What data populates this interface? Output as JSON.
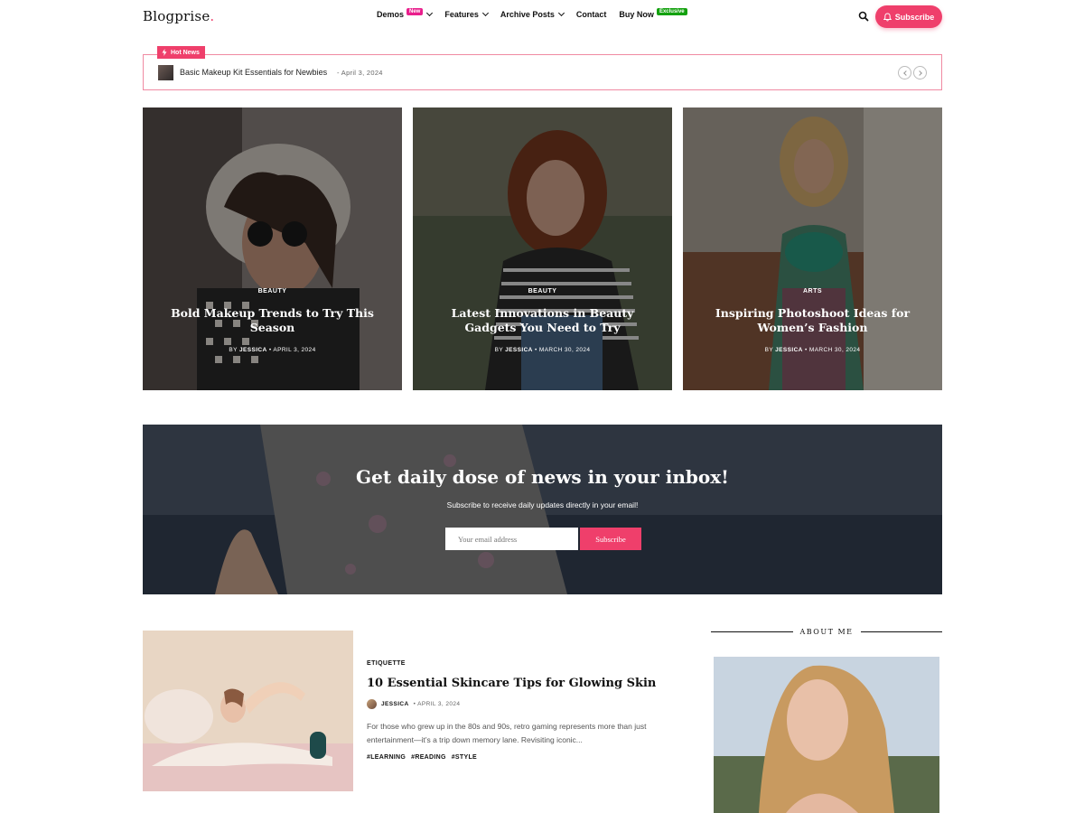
{
  "header": {
    "logo": "Blogprise",
    "logo_dot": ".",
    "nav": [
      {
        "label": "Demos",
        "badge": "New",
        "dropdown": true
      },
      {
        "label": "Features",
        "dropdown": true
      },
      {
        "label": "Archive Posts",
        "dropdown": true
      },
      {
        "label": "Contact",
        "dropdown": false
      },
      {
        "label": "Buy Now",
        "badge": "Exclusive",
        "dropdown": false
      }
    ],
    "search_icon": "search-icon",
    "subscribe_label": "Subscribe",
    "accent_color": "#ef3f6b"
  },
  "ticker": {
    "label": "Hot News",
    "title": "Basic Makeup Kit Essentials for Newbies",
    "date": "- April 3, 2024"
  },
  "featured": [
    {
      "category": "BEAUTY",
      "title": "Bold Makeup Trends to Try This Season",
      "by": "BY",
      "author": "JESSICA",
      "date": "• APRIL 3, 2024"
    },
    {
      "category": "BEAUTY",
      "title": "Latest Innovations in Beauty Gadgets You Need to Try",
      "by": "BY",
      "author": "JESSICA",
      "date": "• MARCH 30, 2024"
    },
    {
      "category": "ARTS",
      "title": "Inspiring Photoshoot Ideas for Women’s Fashion",
      "by": "BY",
      "author": "JESSICA",
      "date": "• MARCH 30, 2024"
    }
  ],
  "newsletter": {
    "title": "Get daily dose of news in your inbox!",
    "subtitle": "Subscribe to receive daily updates directly in your email!",
    "placeholder": "Your email address",
    "button": "Subscribe"
  },
  "post": {
    "category": "ETIQUETTE",
    "title": "10 Essential Skincare Tips for Glowing Skin",
    "author": "JESSICA",
    "date": "• APRIL 3, 2024",
    "excerpt": "For those who grew up in the 80s and 90s, retro gaming represents more than just entertainment—it’s a trip down memory lane. Revisiting iconic...",
    "tags": [
      "#LEARNING",
      "#READING",
      "#STYLE"
    ]
  },
  "sidebar": {
    "about_heading": "ABOUT ME"
  }
}
